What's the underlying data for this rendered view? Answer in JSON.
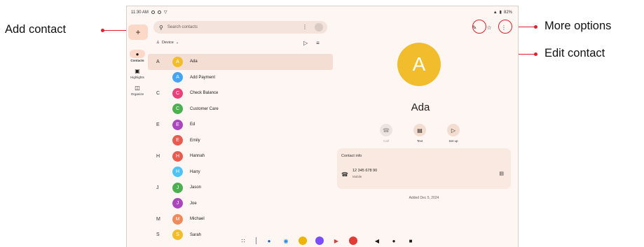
{
  "status": {
    "time": "11:30 AM",
    "battery": "82%"
  },
  "app": {
    "add_contact_glyph": "+",
    "rail": [
      {
        "label": "Contacts",
        "icon": "person-icon",
        "active": true
      },
      {
        "label": "Highlights",
        "icon": "highlights-icon",
        "active": false
      },
      {
        "label": "Organize",
        "icon": "organize-icon",
        "active": false
      }
    ],
    "search": {
      "placeholder": "Search contacts"
    },
    "account_filter": "Device"
  },
  "contacts": [
    {
      "section": "A",
      "initial": "A",
      "name": "Ada",
      "color": "#f2bd2d",
      "selected": true
    },
    {
      "section": "",
      "initial": "A",
      "name": "Add Payment",
      "color": "#42a5f5"
    },
    {
      "section": "C",
      "initial": "C",
      "name": "Check Balance",
      "color": "#ec407a"
    },
    {
      "section": "",
      "initial": "C",
      "name": "Customer Care",
      "color": "#4caf50"
    },
    {
      "section": "E",
      "initial": "E",
      "name": "Ed",
      "color": "#ab47bc"
    },
    {
      "section": "",
      "initial": "E",
      "name": "Emily",
      "color": "#e85b4f"
    },
    {
      "section": "H",
      "initial": "H",
      "name": "Hannah",
      "color": "#e85b4f"
    },
    {
      "section": "",
      "initial": "H",
      "name": "Harry",
      "color": "#4fc3f7"
    },
    {
      "section": "J",
      "initial": "J",
      "name": "Jason",
      "color": "#4caf50"
    },
    {
      "section": "",
      "initial": "J",
      "name": "Joe",
      "color": "#ab47bc"
    },
    {
      "section": "M",
      "initial": "M",
      "name": "Michael",
      "color": "#f08a5d"
    },
    {
      "section": "S",
      "initial": "S",
      "name": "Sarah",
      "color": "#f2bd2d"
    }
  ],
  "detail": {
    "initial": "A",
    "name": "Ada",
    "actions": [
      {
        "label": "Call",
        "icon": "phone-icon",
        "disabled": true
      },
      {
        "label": "Text",
        "icon": "message-icon",
        "disabled": false
      },
      {
        "label": "Set up",
        "icon": "video-icon",
        "disabled": false
      }
    ],
    "info_header": "Contact info",
    "phone": "12 345 678 90",
    "phone_type": "Mobile",
    "added": "Added Dec 5, 2024"
  },
  "annotations": {
    "add_contact": "Add contact",
    "more_options": "More  options",
    "edit_contact": "Edit contact"
  },
  "colors": {
    "accent": "#e0202a",
    "fab": "#fbd8c7",
    "background": "#fdf6f3"
  }
}
